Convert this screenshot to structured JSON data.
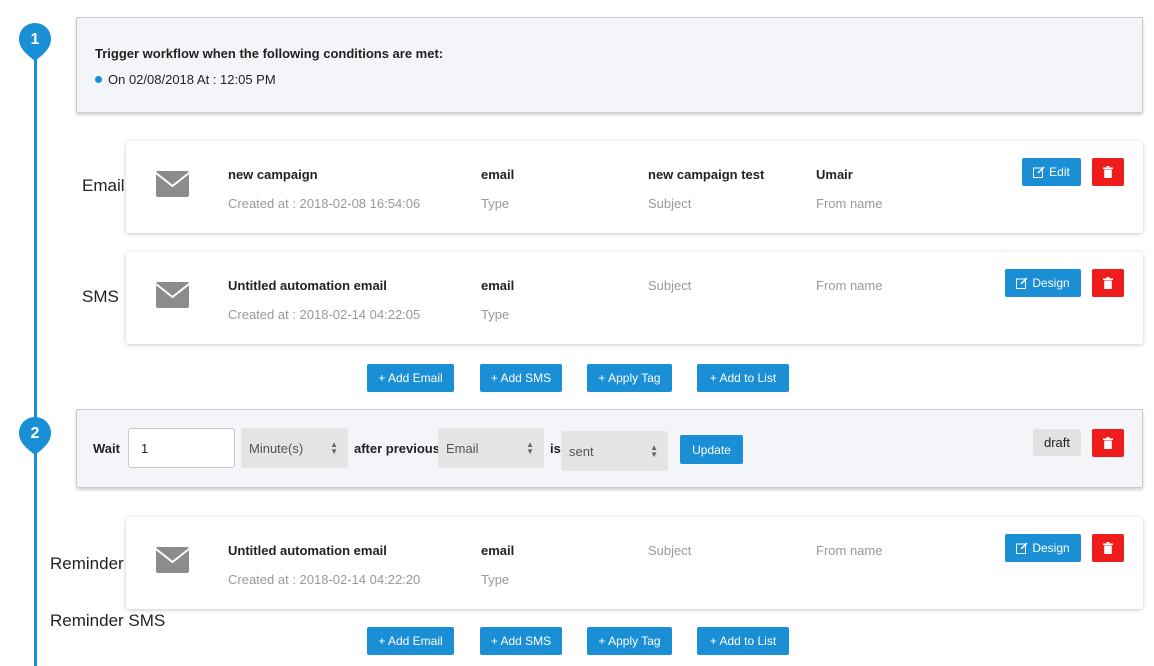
{
  "steps": [
    "1",
    "2"
  ],
  "trigger": {
    "title": "Trigger workflow when the following conditions are met:",
    "condition": "On 02/08/2018 At : 12:05 PM"
  },
  "side_labels": {
    "email": "Email",
    "sms": "SMS",
    "reminder": "Reminder",
    "reminder_sms": "Reminder SMS"
  },
  "cards": [
    {
      "name": "new campaign",
      "created": "Created at : 2018-02-08 16:54:06",
      "type_value": "email",
      "type_label": "Type",
      "subject_value": "new campaign test",
      "subject_label": "Subject",
      "from_value": "Umair",
      "from_label": "From name",
      "action": "Edit"
    },
    {
      "name": "Untitled automation email",
      "created": "Created at : 2018-02-14 04:22:05",
      "type_value": "email",
      "type_label": "Type",
      "subject_label": "Subject",
      "from_label": "From name",
      "action": "Design"
    },
    {
      "name": "Untitled automation email",
      "created": "Created at : 2018-02-14 04:22:20",
      "type_value": "email",
      "type_label": "Type",
      "subject_label": "Subject",
      "from_label": "From name",
      "action": "Design"
    }
  ],
  "add_buttons": {
    "email": "+ Add Email",
    "sms": "+ Add SMS",
    "tag": "+ Apply Tag",
    "list": "+ Add to List"
  },
  "wait": {
    "label": "Wait",
    "value": "1",
    "unit": "Minute(s)",
    "after_label": "after previous",
    "previous": "Email",
    "is_label": "is",
    "status": "sent",
    "update": "Update",
    "state": "draft"
  },
  "colors": {
    "accent": "#1a8fd6",
    "danger": "#ee1c1c",
    "panel": "#f4f5f9"
  },
  "icons": [
    "envelope-icon",
    "edit-icon",
    "trash-icon",
    "sort-arrows-icon"
  ]
}
